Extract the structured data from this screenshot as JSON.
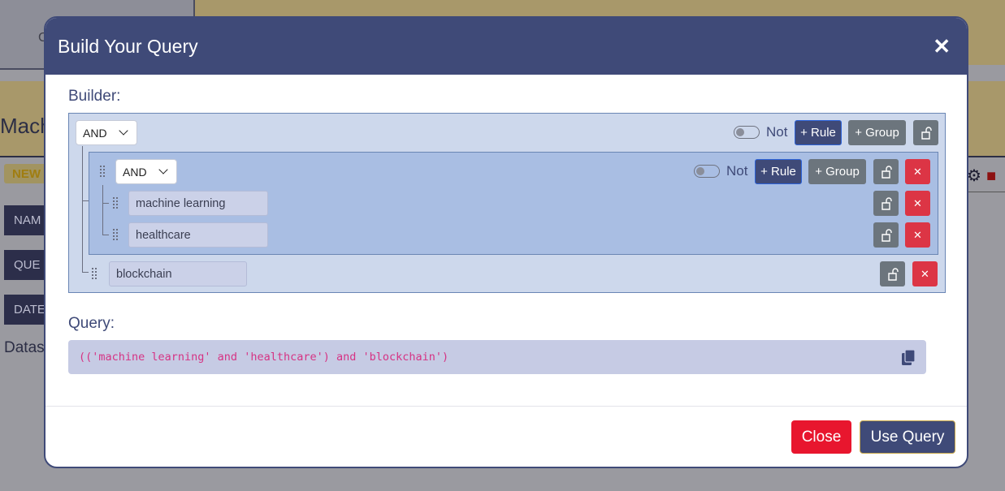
{
  "background": {
    "left_box_text": "C",
    "title_fragment": "Mach",
    "new_badge": "NEW",
    "labels": [
      "NAM",
      "QUE",
      "DATE"
    ],
    "datasets_fragment": "Datas"
  },
  "modal": {
    "title": "Build Your Query",
    "close_glyph": "✕",
    "builder_label": "Builder:",
    "query_label": "Query:",
    "root_group": {
      "combinator": "AND",
      "not_label": "Not",
      "add_rule_label": "+ Rule",
      "add_group_label": "+ Group",
      "subgroup": {
        "combinator": "AND",
        "not_label": "Not",
        "add_rule_label": "+ Rule",
        "add_group_label": "+ Group",
        "rules": [
          {
            "value": "machine learning"
          },
          {
            "value": "healthcare"
          }
        ]
      },
      "rules": [
        {
          "value": "blockchain"
        }
      ]
    },
    "query_text": "(('machine learning' and 'healthcare') and 'blockchain')",
    "delete_glyph": "✕",
    "footer": {
      "close_label": "Close",
      "use_label": "Use Query"
    }
  },
  "colors": {
    "primary": "#3f4a78",
    "danger": "#dc3545",
    "secondary": "#6c757d",
    "query_text": "#d63384"
  },
  "icons": [
    "lock-icon",
    "delete-icon",
    "drag-handle-icon",
    "copy-icon",
    "close-icon",
    "chevron-down-icon"
  ]
}
